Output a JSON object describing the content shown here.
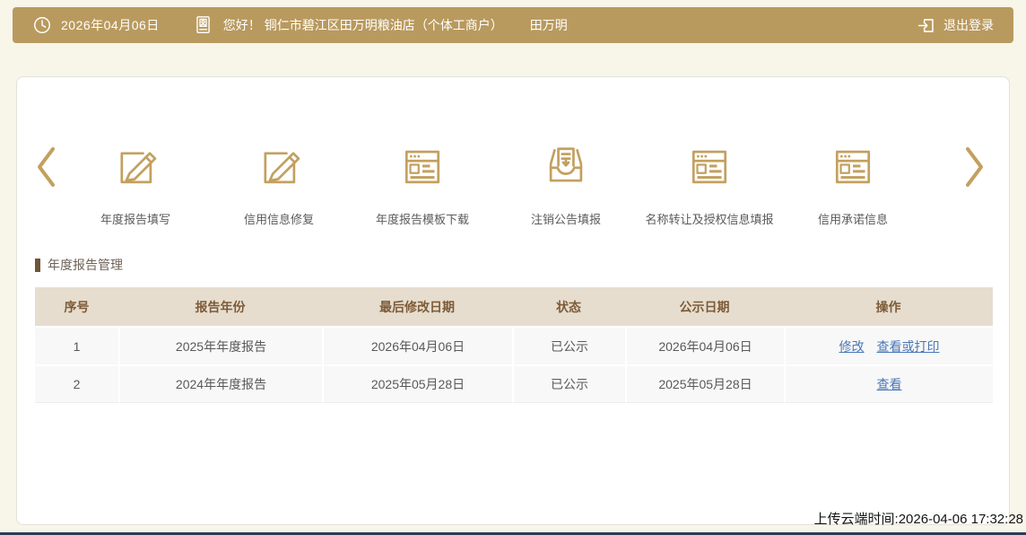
{
  "colors": {
    "topbar_gold": "#b99a5e",
    "icon_gold": "#c3a05f",
    "page_background": "#f8f5e9",
    "table_header_bg": "#e6ddcf",
    "table_header_text": "#7d5b36",
    "row_bg": "#f8f8f8",
    "link_blue": "#4a77b5",
    "bottom_bar_navy": "#2b3b57"
  },
  "header": {
    "date": "2026年04月06日",
    "greeting": "您好！",
    "company": "铜仁市碧江区田万明粮油店（个体工商户）",
    "username": "田万明",
    "logout_label": "退出登录"
  },
  "carousel": {
    "items": [
      {
        "label": "年度报告填写",
        "icon": "edit-square-icon"
      },
      {
        "label": "信用信息修复",
        "icon": "edit-square-icon"
      },
      {
        "label": "年度报告模板下载",
        "icon": "browser-doc-icon"
      },
      {
        "label": "注销公告填报",
        "icon": "inbox-icon"
      },
      {
        "label": "名称转让及授权信息填报",
        "icon": "browser-doc-icon"
      },
      {
        "label": "信用承诺信息",
        "icon": "browser-doc-icon"
      }
    ]
  },
  "section": {
    "title": "年度报告管理"
  },
  "table": {
    "headers": [
      "序号",
      "报告年份",
      "最后修改日期",
      "状态",
      "公示日期",
      "操作"
    ],
    "rows": [
      {
        "seq": "1",
        "year": "2025年年度报告",
        "modified": "2026年04月06日",
        "status": "已公示",
        "publish_date": "2026年04月06日",
        "actions": [
          "修改",
          "查看或打印"
        ]
      },
      {
        "seq": "2",
        "year": "2024年年度报告",
        "modified": "2025年05月28日",
        "status": "已公示",
        "publish_date": "2025年05月28日",
        "actions": [
          "查看"
        ]
      }
    ]
  },
  "footer": {
    "upload_time": "上传云端时间:2026-04-06 17:32:28"
  }
}
